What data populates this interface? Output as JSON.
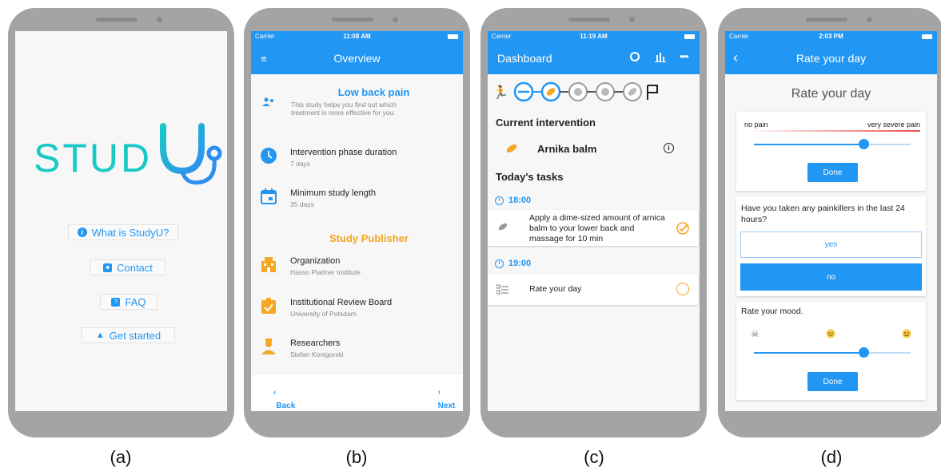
{
  "captions": [
    "(a)",
    "(b)",
    "(c)",
    "(d)"
  ],
  "a": {
    "logo_text": "STUD",
    "buttons": [
      {
        "label": "What is StudyU?",
        "icon": "info-icon"
      },
      {
        "label": "Contact",
        "icon": "contact-card-icon"
      },
      {
        "label": "FAQ",
        "icon": "faq-icon"
      },
      {
        "label": "Get started",
        "icon": "rocket-icon"
      }
    ]
  },
  "b": {
    "status": {
      "carrier": "Carrier",
      "time": "11:08 AM"
    },
    "title": "Overview",
    "study": {
      "title": "Low back pain",
      "description": "This study helps you find out which treatment is more effective for you"
    },
    "rows": [
      {
        "title": "Intervention phase duration",
        "sub": "7 days"
      },
      {
        "title": "Minimum study length",
        "sub": "35 days"
      }
    ],
    "publisher_title": "Study Publisher",
    "publisher_rows": [
      {
        "title": "Organization",
        "sub": "Hasso Plattner Institute"
      },
      {
        "title": "Institutional Review Board",
        "sub": "University of Potsdam"
      },
      {
        "title": "Researchers",
        "sub": "Stefan Konigorski"
      }
    ],
    "back": "Back",
    "next": "Next"
  },
  "c": {
    "status": {
      "carrier": "Carrier",
      "time": "11:19 AM"
    },
    "title": "Dashboard",
    "current_intervention_label": "Current intervention",
    "intervention": "Arnika balm",
    "tasks_label": "Today's tasks",
    "tasks": [
      {
        "time": "18:00",
        "text": "Apply a dime-sized amount of arnica balm to your lower back and massage for 10 min"
      },
      {
        "time": "19:00",
        "text": "Rate your day"
      }
    ]
  },
  "d": {
    "status": {
      "carrier": "Carrier",
      "time": "2:03 PM"
    },
    "title": "Rate your day",
    "heading": "Rate your day",
    "pain": {
      "min": "no pain",
      "max": "very severe pain",
      "value": 0.7,
      "done": "Done"
    },
    "question": "Have you taken any painkillers in the last 24 hours?",
    "yes": "yes",
    "no": "no",
    "mood": {
      "label": "Rate your mood.",
      "value": 0.7,
      "done": "Done"
    }
  },
  "colors": {
    "primary": "#2196F3",
    "accent": "#f5a623",
    "logo": "#18c9c6"
  }
}
